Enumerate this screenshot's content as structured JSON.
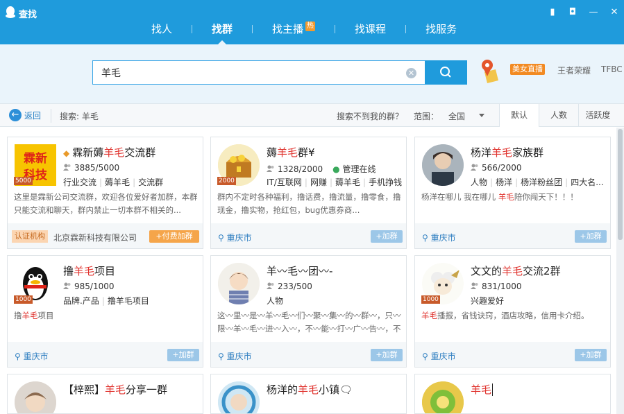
{
  "window": {
    "title": "查找"
  },
  "nav": {
    "tabs": [
      {
        "label": "找人"
      },
      {
        "label": "找群"
      },
      {
        "label": "找主播",
        "badge": "热"
      },
      {
        "label": "找课程"
      },
      {
        "label": "找服务"
      }
    ],
    "active": "找群"
  },
  "search": {
    "value": "羊毛"
  },
  "promo": {
    "badge": "美女直播",
    "tags": [
      "王者荣耀",
      "TFBC"
    ]
  },
  "filter": {
    "back_label": "返回",
    "search_label": "搜索: 羊毛",
    "not_found": "搜索不到我的群？",
    "scope_label": "范围：",
    "scope_value": "全国",
    "sort_tabs": [
      "默认",
      "人数",
      "活跃度"
    ]
  },
  "cards": [
    {
      "name_pre": "霖新薅",
      "name_hl": "羊毛",
      "name_post": "交流群",
      "members": "3885/5000",
      "tags": [
        "行业交流",
        "薅羊毛",
        "交流群"
      ],
      "desc_pre": "这里是霖新公司交流群，欢迎各位爱好者加群，本群只能交流和聊天，群内禁止一切本群不相关的...",
      "badge": "5000",
      "cert": "认证机构",
      "company": "北京霖新科技有限公司",
      "action": "+付费加群",
      "avatar_text": "霖新科技"
    },
    {
      "name_pre": "薅",
      "name_hl": "羊毛",
      "name_post": "群¥",
      "members": "1328/2000",
      "admin": "管理在线",
      "tags": [
        "IT/互联网",
        "网赚",
        "薅羊毛",
        "手机挣钱"
      ],
      "desc_pre": "群内不定时各种福利，撸话费，撸流量，撸零食，撸现金，撸实物，抢红包，bug优惠券商...",
      "badge": "2000",
      "location": "重庆市",
      "action": "+加群"
    },
    {
      "name_pre": "杨洋",
      "name_hl": "羊毛",
      "name_post": "家族群",
      "members": "566/2000",
      "tags": [
        "人物",
        "杨洋",
        "杨洋粉丝团",
        "四大名..."
      ],
      "desc_pre": "杨洋在哪儿 我在哪儿 ",
      "desc_hl": "羊毛",
      "desc_post": "陪你闯天下！！！",
      "location": "重庆市",
      "action": "+加群"
    },
    {
      "name_pre": "撸",
      "name_hl": "羊毛",
      "name_post": "项目",
      "members": "985/1000",
      "tags": [
        "品牌.产品",
        "撸羊毛项目"
      ],
      "desc_pre": "撸",
      "desc_hl": "羊毛",
      "desc_post": "项目",
      "badge": "1000",
      "location": "重庆市",
      "action": "+加群"
    },
    {
      "name_pre": "羊",
      "name_hl": "",
      "name_post": "〰毛〰团〰-",
      "members": "233/500",
      "tags": [
        "人物"
      ],
      "desc_pre": "这〰里〰是〰羊〰毛〰们〰聚〰集〰的〰群〰，只〰限〰羊〰毛〰进〰入〰，不〰能〰打〰广〰告〰，不〰能〰发〰黄〰色〰，黑〰粉...",
      "location": "重庆市",
      "action": "+加群"
    },
    {
      "name_pre": "文文的",
      "name_hl": "羊毛",
      "name_post": "交流2群",
      "members": "831/1000",
      "tags": [
        "兴趣爱好"
      ],
      "desc_pre": "",
      "desc_hl": "羊毛",
      "desc_post": "播报，省钱诀窍，酒店攻略，信用卡介绍。",
      "badge": "1000",
      "location": "重庆市",
      "action": "+加群"
    },
    {
      "name_pre": "【梓熙】",
      "name_hl": "羊毛",
      "name_post": "分享一群"
    },
    {
      "name_pre": "杨洋的",
      "name_hl": "羊毛",
      "name_post": "小镇🗨"
    },
    {
      "name_pre": "",
      "name_hl": "羊毛",
      "name_post": ""
    }
  ]
}
